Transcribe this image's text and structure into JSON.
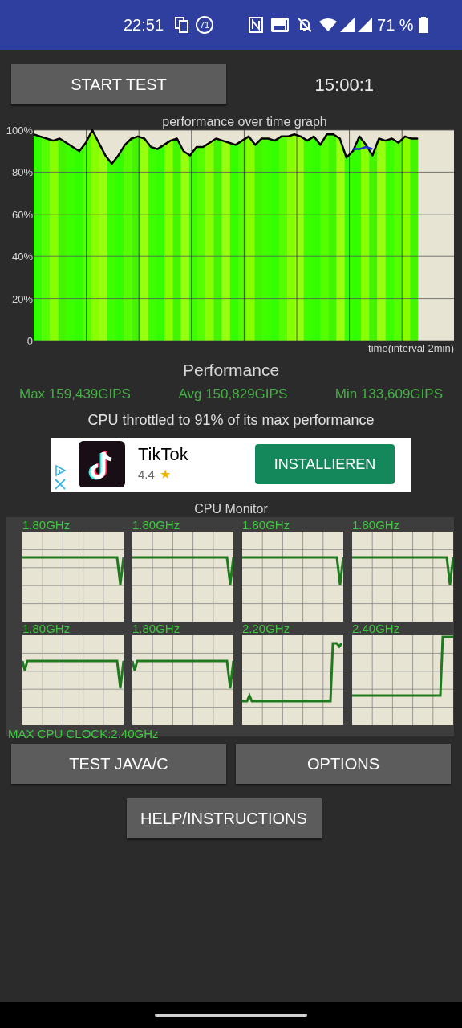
{
  "status_bar": {
    "time": "22:51",
    "notification_count": "71",
    "battery": "71 %"
  },
  "start_button": "START TEST",
  "timer": "15:00:1",
  "graph": {
    "chart_data": {
      "type": "line",
      "title": "performance over time graph",
      "xlabel": "time(interval 2min)",
      "grid": true,
      "ylim": [
        0,
        100
      ],
      "yticks": [
        {
          "value": 0,
          "label": "0"
        },
        {
          "value": 20,
          "label": "20%"
        },
        {
          "value": 40,
          "label": "40%"
        },
        {
          "value": 60,
          "label": "60%"
        },
        {
          "value": 80,
          "label": "80%"
        },
        {
          "value": 100,
          "label": "100%"
        }
      ],
      "series": [
        {
          "color": "#000000",
          "values": [
            98,
            97,
            96,
            95,
            96,
            94,
            92,
            90,
            94,
            100,
            94,
            88,
            84,
            88,
            93,
            96,
            97,
            96,
            92,
            91,
            93,
            95,
            96,
            90,
            88,
            92,
            92,
            94,
            96,
            95,
            94,
            93,
            95,
            97,
            93,
            96,
            96,
            95,
            97,
            97,
            98,
            97,
            95,
            97,
            93,
            98,
            98,
            96,
            87,
            90,
            97,
            93,
            88,
            96,
            95,
            96,
            94,
            97,
            96,
            96
          ]
        },
        {
          "color": "#1e2fd0",
          "values": [
            null,
            null,
            null,
            null,
            null,
            null,
            null,
            null,
            null,
            null,
            null,
            null,
            null,
            null,
            null,
            null,
            null,
            null,
            null,
            null,
            null,
            null,
            null,
            null,
            null,
            null,
            null,
            null,
            null,
            null,
            null,
            null,
            null,
            null,
            null,
            null,
            null,
            null,
            null,
            null,
            null,
            null,
            null,
            null,
            null,
            null,
            null,
            null,
            null,
            91,
            91,
            92,
            91,
            null,
            null,
            null,
            null,
            null,
            null,
            null
          ]
        }
      ]
    }
  },
  "performance": {
    "title": "Performance",
    "max": "Max 159,439GIPS",
    "avg": "Avg 150,829GIPS",
    "min": "Min 133,609GIPS",
    "throttle_note": "CPU throttled to 91% of its max performance"
  },
  "ad": {
    "app_name": "TikTok",
    "rating": "4.4",
    "stars": 1,
    "button": "INSTALLIEREN"
  },
  "cpu_monitor": {
    "title": "CPU Monitor",
    "cores": [
      {
        "freq": "1.80GHz"
      },
      {
        "freq": "1.80GHz"
      },
      {
        "freq": "1.80GHz"
      },
      {
        "freq": "1.80GHz"
      },
      {
        "freq": "1.80GHz"
      },
      {
        "freq": "1.80GHz"
      },
      {
        "freq": "2.20GHz"
      },
      {
        "freq": "2.40GHz"
      }
    ],
    "max_clock": "MAX CPU CLOCK:2.40GHz"
  },
  "buttons": [
    "TEST JAVA/C",
    "OPTIONS"
  ],
  "help_button": "HELP/INSTRUCTIONS"
}
